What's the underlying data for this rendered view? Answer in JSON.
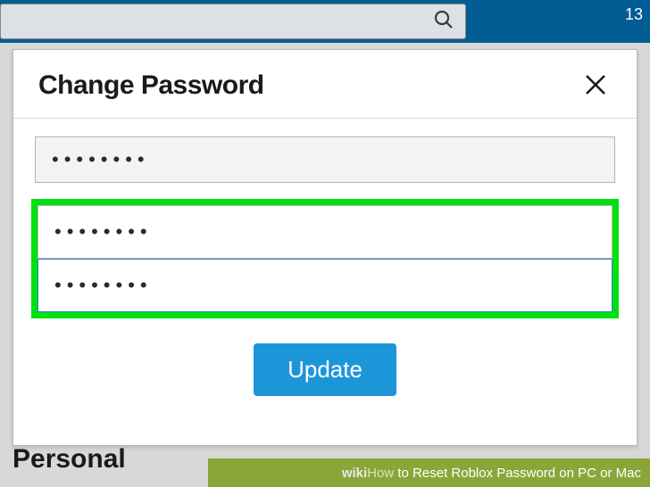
{
  "topbar": {
    "clock": "13"
  },
  "background": {
    "section_label": "Personal"
  },
  "modal": {
    "title": "Change Password",
    "current_password_value": "••••••••",
    "new_password_value": "••••••••",
    "confirm_password_value": "••••••••",
    "update_label": "Update"
  },
  "watermark": {
    "brand_prefix": "wiki",
    "brand_suffix": "How",
    "article": " to Reset Roblox Password on PC or Mac"
  }
}
